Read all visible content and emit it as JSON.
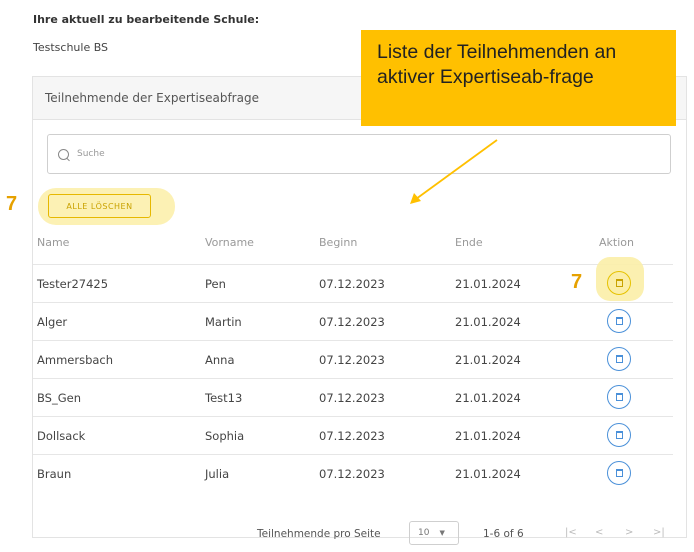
{
  "school": {
    "label": "Ihre aktuell zu bearbeitende Schule:",
    "name": "Testschule BS"
  },
  "card": {
    "title": "Teilnehmende der Expertiseabfrage"
  },
  "search": {
    "placeholder": "Suche"
  },
  "actions": {
    "delete_all": "ALLE LÖSCHEN"
  },
  "table": {
    "headers": {
      "name": "Name",
      "first": "Vorname",
      "start": "Beginn",
      "end": "Ende",
      "action": "Aktion"
    },
    "rows": [
      {
        "name": "Tester27425",
        "first": "Pen",
        "start": "07.12.2023",
        "end": "21.01.2024"
      },
      {
        "name": "Alger",
        "first": "Martin",
        "start": "07.12.2023",
        "end": "21.01.2024"
      },
      {
        "name": "Ammersbach",
        "first": "Anna",
        "start": "07.12.2023",
        "end": "21.01.2024"
      },
      {
        "name": "BS_Gen",
        "first": "Test13",
        "start": "07.12.2023",
        "end": "21.01.2024"
      },
      {
        "name": "Dollsack",
        "first": "Sophia",
        "start": "07.12.2023",
        "end": "21.01.2024"
      },
      {
        "name": "Braun",
        "first": "Julia",
        "start": "07.12.2023",
        "end": "21.01.2024"
      }
    ]
  },
  "pagination": {
    "rows_per_page_label": "Teilnehmende pro Seite",
    "rows_per_page": "10",
    "range": "1-6 of 6"
  },
  "annotation": {
    "callout_text": "Liste der Teilnehmenden an aktiver Expertiseab-frage",
    "marker": "7",
    "color": "#ffc000"
  }
}
